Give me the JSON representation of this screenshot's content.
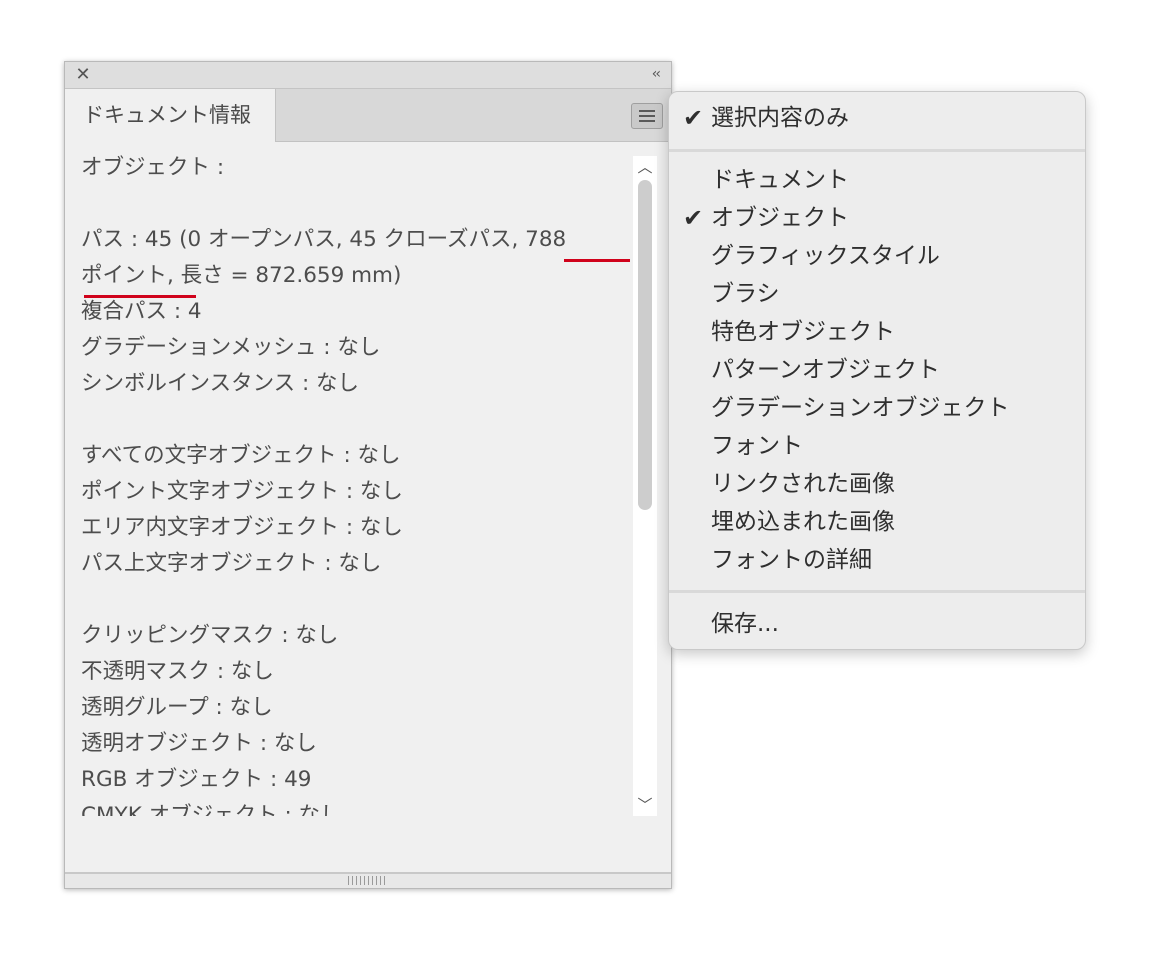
{
  "panel": {
    "title_icons": {
      "close": "close-icon",
      "collapse": "double-chevron-left-icon"
    },
    "tab_label": "ドキュメント情報",
    "lines": [
      "オブジェクト :",
      "",
      "パス : 45 (0 オープンパス, 45 クローズパス, 788",
      "ポイント, 長さ = 872.659 mm)",
      "複合パス : 4",
      "グラデーションメッシュ : なし",
      "シンボルインスタンス : なし",
      "",
      "すべての文字オブジェクト : なし",
      "ポイント文字オブジェクト : なし",
      "エリア内文字オブジェクト : なし",
      "パス上文字オブジェクト : なし",
      "",
      "クリッピングマスク : なし",
      "不透明マスク : なし",
      "透明グループ : なし",
      "透明オブジェクト : なし",
      "RGB オブジェクト : 49",
      "CMYK オブジェクト : なし"
    ],
    "highlight_color": "#d0021b"
  },
  "menu": {
    "check_glyph": "✔",
    "top_item": {
      "label": "選択内容のみ",
      "checked": true
    },
    "items": [
      {
        "label": "ドキュメント",
        "checked": false
      },
      {
        "label": "オブジェクト",
        "checked": true
      },
      {
        "label": "グラフィックスタイル",
        "checked": false
      },
      {
        "label": "ブラシ",
        "checked": false
      },
      {
        "label": "特色オブジェクト",
        "checked": false
      },
      {
        "label": "パターンオブジェクト",
        "checked": false
      },
      {
        "label": "グラデーションオブジェクト",
        "checked": false
      },
      {
        "label": "フォント",
        "checked": false
      },
      {
        "label": "リンクされた画像",
        "checked": false
      },
      {
        "label": "埋め込まれた画像",
        "checked": false
      },
      {
        "label": "フォントの詳細",
        "checked": false
      }
    ],
    "save_label": "保存..."
  }
}
